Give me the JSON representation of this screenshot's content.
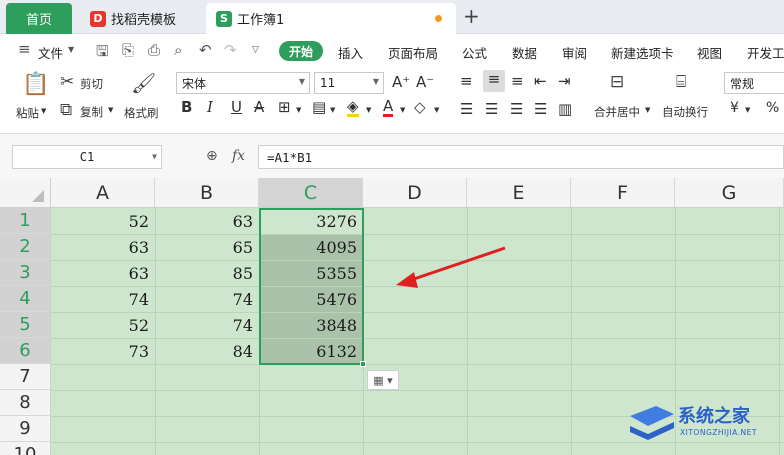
{
  "tabs": {
    "home": "首页",
    "template": "找稻壳模板",
    "workbook": "工作簿1",
    "add": "+"
  },
  "menu": {
    "file": "文件",
    "start": "开始",
    "insert": "插入",
    "page_layout": "页面布局",
    "formula": "公式",
    "data": "数据",
    "review": "审阅",
    "new_tab": "新建选项卡",
    "view": "视图",
    "dev": "开发工"
  },
  "ribbon": {
    "paste": "粘贴",
    "cut": "剪切",
    "copy": "复制",
    "format_painter": "格式刷",
    "font_name": "宋体",
    "font_size": "11",
    "merge_center": "合并居中",
    "wrap_text": "自动换行",
    "number_format": "常规"
  },
  "formula_bar": {
    "name_box": "C1",
    "formula": "=A1*B1"
  },
  "grid": {
    "columns": [
      "A",
      "B",
      "C",
      "D",
      "E",
      "F",
      "G"
    ],
    "rows": [
      "1",
      "2",
      "3",
      "4",
      "5",
      "6",
      "7",
      "8",
      "9",
      "10"
    ],
    "selected_column": "C",
    "selected_rows": [
      "1",
      "2",
      "3",
      "4",
      "5",
      "6"
    ],
    "data": [
      [
        "52",
        "63",
        "3276"
      ],
      [
        "63",
        "65",
        "4095"
      ],
      [
        "63",
        "85",
        "5355"
      ],
      [
        "74",
        "74",
        "5476"
      ],
      [
        "52",
        "74",
        "3848"
      ],
      [
        "73",
        "84",
        "6132"
      ]
    ]
  },
  "watermark": {
    "title": "系统之家",
    "subtitle": "XITONGZHIJIA.NET"
  },
  "colors": {
    "accent_green": "#2e9e5d",
    "sheet_background": "#cde6cd",
    "arrow_red": "#e0201e"
  }
}
